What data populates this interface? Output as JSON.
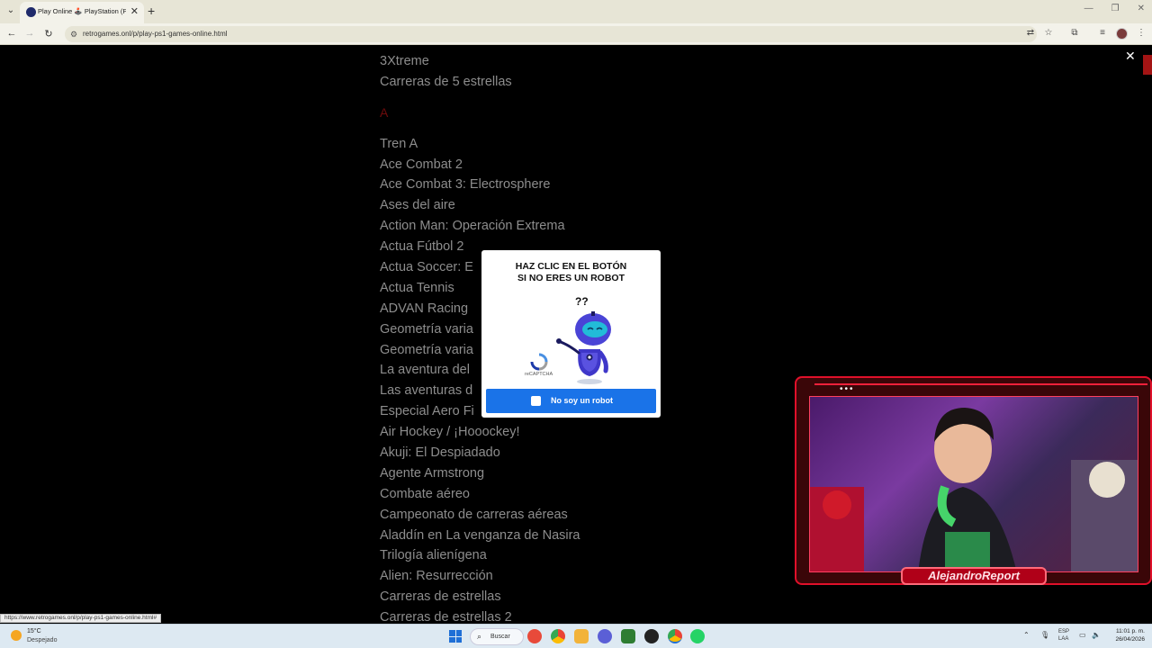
{
  "browser": {
    "tab_title": "Play Online 🕹️ PlayStation (P...",
    "url": "retrogames.onl/p/play-ps1-games-online.html",
    "status_url": "https://www.retrogames.onl/p/play-ps1-games-online.html#"
  },
  "page": {
    "games_top": [
      "3Xtreme",
      "Carreras de 5 estrellas"
    ],
    "letter_heading": "A",
    "games": [
      "Tren A",
      "Ace Combat 2",
      "Ace Combat 3: Electrosphere",
      "Ases del aire",
      "Action Man: Operación Extrema",
      "Actua Fútbol 2",
      "Actua Soccer: E",
      "Actua Tennis",
      "ADVAN Racing",
      "Geometría varia",
      "Geometría varia",
      "La aventura del",
      "Las aventuras d",
      "Especial Aero Fi",
      "Air Hockey / ¡Hooockey!",
      "Akuji: El Despiadado",
      "Agente Armstrong",
      "Combate aéreo",
      "Campeonato de carreras aéreas",
      "Aladdín en La venganza de Nasira",
      "Trilogía alienígena",
      "Alien: Resurrección",
      "Carreras de estrellas",
      "Carreras de estrellas 2"
    ]
  },
  "captcha": {
    "title_line1": "HAZ CLIC EN EL BOTÓN",
    "title_line2": "SI NO ERES UN ROBOT",
    "question_marks": "??",
    "recaptcha_label": "reCAPTCHA",
    "button_label": "No soy un robot"
  },
  "webcam": {
    "name": "AlejandroReport"
  },
  "taskbar": {
    "weather_temp": "15°C",
    "weather_desc": "Despejado",
    "search_label": "Buscar",
    "lang_line1": "ESP",
    "lang_line2": "LAA",
    "time": "11:01 p. m.",
    "date": "26/04/2026"
  }
}
